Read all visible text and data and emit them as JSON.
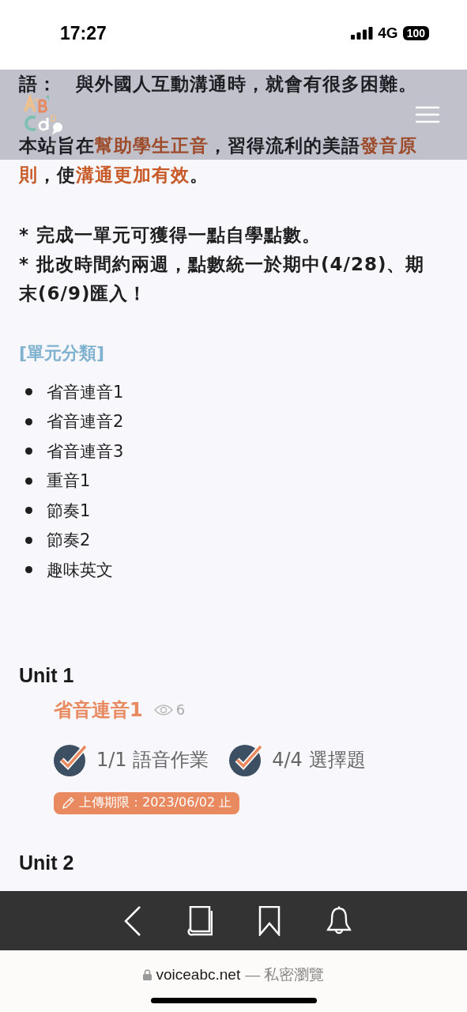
{
  "status_bar": {
    "time": "17:27",
    "network": "4G",
    "battery": "100"
  },
  "intro": [
    "語：　與外國人互動溝通時，就會有很多困難。",
    "本站旨在**幫助學生正音**，習得流利的美語**發音原則**，使**溝通更加有效**。"
  ],
  "notes": [
    "* 完成一單元可獲得一點自學點數。",
    "* 批改時間約兩週，點數統一於期中(4/28)、期末(6/9)匯入！"
  ],
  "category_heading": "[單元分類]",
  "categories": [
    "省音連音1",
    "省音連音2",
    "省音連音3",
    "重音1",
    "節奏1",
    "節奏2",
    "趣味英文"
  ],
  "units": [
    {
      "heading": "Unit 1",
      "lesson": {
        "title": "省音連音1",
        "views": "6",
        "tasks": [
          {
            "progress": "1/1",
            "label": "語音作業",
            "completed": true
          },
          {
            "progress": "4/4",
            "label": "選擇題",
            "completed": true
          }
        ],
        "deadline": "上傳期限：2023/06/02 止"
      }
    },
    {
      "heading": "Unit 2"
    }
  ],
  "browser": {
    "domain": "voiceabc.net",
    "mode": "— 私密瀏覽"
  }
}
